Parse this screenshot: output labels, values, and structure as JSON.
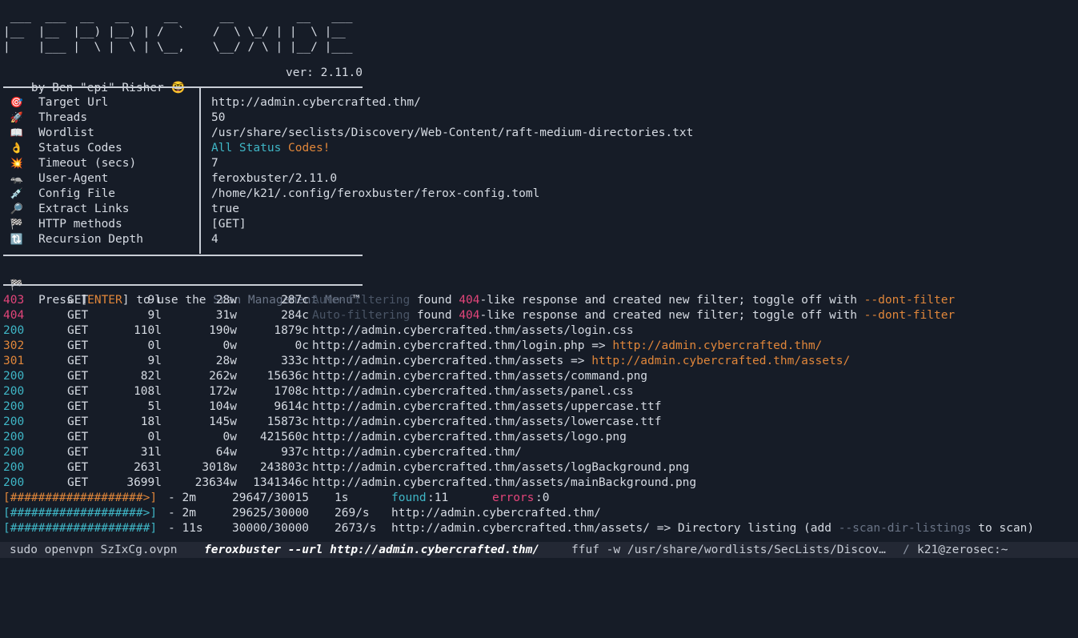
{
  "banner": {
    "ascii_art": " ___  ___  __   __     __      __         __   ___\n|__  |__  |__) |__) | /  `    /  \\ \\_/ | |  \\ |__\n|    |___ |  \\ |  \\ | \\__,    \\__/ / \\ | |__/ |___",
    "byline": "by Ben \"epi\" Risher 🤓",
    "version": "ver: 2.11.0"
  },
  "config": [
    {
      "icon": "🎯",
      "icon_name": "target-icon",
      "key": "Target Url",
      "value": "http://admin.cybercrafted.thm/"
    },
    {
      "icon": "🚀",
      "icon_name": "rocket-icon",
      "key": "Threads",
      "value": "50"
    },
    {
      "icon": "📖",
      "icon_name": "book-icon",
      "key": "Wordlist",
      "value": "/usr/share/seclists/Discovery/Web-Content/raft-medium-directories.txt"
    },
    {
      "icon": "👌",
      "icon_name": "ok-hand-icon",
      "key": "Status Codes",
      "value": ""
    },
    {
      "icon": "💥",
      "icon_name": "explosion-icon",
      "key": "Timeout (secs)",
      "value": "7"
    },
    {
      "icon": "🦡",
      "icon_name": "badger-icon",
      "key": "User-Agent",
      "value": "feroxbuster/2.11.0"
    },
    {
      "icon": "💉",
      "icon_name": "syringe-icon",
      "key": "Config File",
      "value": "/home/k21/.config/feroxbuster/ferox-config.toml"
    },
    {
      "icon": "🔎",
      "icon_name": "magnifier-icon",
      "key": "Extract Links",
      "value": "true"
    },
    {
      "icon": "🏁",
      "icon_name": "checkered-flag-icon",
      "key": "HTTP methods",
      "value": "[GET]"
    },
    {
      "icon": "🔃",
      "icon_name": "recursion-icon",
      "key": "Recursion Depth",
      "value": "4"
    }
  ],
  "status_codes_value": {
    "part1": "All",
    "part2": "Status",
    "part3": "Codes!"
  },
  "press_enter": {
    "icon": "🏁",
    "before": "Press [",
    "key": "ENTER",
    "middle": "] to use the ",
    "menu": "Scan Management Menu",
    "tm": "™"
  },
  "results": [
    {
      "status": "403",
      "method": "GET",
      "lines": "9l",
      "words": "28w",
      "chars": "287c",
      "pre": "Auto-filtering",
      "text": " found ",
      "code": "404",
      "text2": "-like response and created new filter; toggle off with ",
      "flag": "--dont-filter"
    },
    {
      "status": "404",
      "method": "GET",
      "lines": "9l",
      "words": "31w",
      "chars": "284c",
      "pre": "Auto-filtering",
      "text": " found ",
      "code": "404",
      "text2": "-like response and created new filter; toggle off with ",
      "flag": "--dont-filter"
    },
    {
      "status": "200",
      "method": "GET",
      "lines": "110l",
      "words": "190w",
      "chars": "1879c",
      "url": "http://admin.cybercrafted.thm/assets/login.css"
    },
    {
      "status": "302",
      "method": "GET",
      "lines": "0l",
      "words": "0w",
      "chars": "0c",
      "url": "http://admin.cybercrafted.thm/login.php => ",
      "redirect": "http://admin.cybercrafted.thm/"
    },
    {
      "status": "301",
      "method": "GET",
      "lines": "9l",
      "words": "28w",
      "chars": "333c",
      "url": "http://admin.cybercrafted.thm/assets => ",
      "redirect": "http://admin.cybercrafted.thm/assets/"
    },
    {
      "status": "200",
      "method": "GET",
      "lines": "82l",
      "words": "262w",
      "chars": "15636c",
      "url": "http://admin.cybercrafted.thm/assets/command.png"
    },
    {
      "status": "200",
      "method": "GET",
      "lines": "108l",
      "words": "172w",
      "chars": "1708c",
      "url": "http://admin.cybercrafted.thm/assets/panel.css"
    },
    {
      "status": "200",
      "method": "GET",
      "lines": "5l",
      "words": "104w",
      "chars": "9614c",
      "url": "http://admin.cybercrafted.thm/assets/uppercase.ttf"
    },
    {
      "status": "200",
      "method": "GET",
      "lines": "18l",
      "words": "145w",
      "chars": "15873c",
      "url": "http://admin.cybercrafted.thm/assets/lowercase.ttf"
    },
    {
      "status": "200",
      "method": "GET",
      "lines": "0l",
      "words": "0w",
      "chars": "421560c",
      "url": "http://admin.cybercrafted.thm/assets/logo.png"
    },
    {
      "status": "200",
      "method": "GET",
      "lines": "31l",
      "words": "64w",
      "chars": "937c",
      "url": "http://admin.cybercrafted.thm/"
    },
    {
      "status": "200",
      "method": "GET",
      "lines": "263l",
      "words": "3018w",
      "chars": "243803c",
      "url": "http://admin.cybercrafted.thm/assets/logBackground.png"
    },
    {
      "status": "200",
      "method": "GET",
      "lines": "3699l",
      "words": "23634w",
      "chars": "1341346c",
      "url": "http://admin.cybercrafted.thm/assets/mainBackground.png"
    }
  ],
  "progress": [
    {
      "bar": "[###################>]",
      "color": "#e0863a",
      "elapsed": "- 2m",
      "count": "29647/30015",
      "rate": "1s",
      "found_label": "found",
      "found": ":11",
      "errors_label": "errors",
      "errors": ":0"
    },
    {
      "bar": "[###################>]",
      "color": "#3fb6c6",
      "elapsed": "- 2m",
      "count": "29625/30000",
      "rate": "269/s",
      "target": "http://admin.cybercrafted.thm/"
    },
    {
      "bar": "[####################]",
      "color": "#3fb6c6",
      "elapsed": "- 11s",
      "count": "30000/30000",
      "rate": "2673/s",
      "target": "http://admin.cybercrafted.thm/assets/ => Directory listing (add ",
      "flag": "--scan-dir-listings",
      "tail": " to scan)"
    }
  ],
  "statusbar": {
    "tab1": "sudo openvpn SzIxCg.ovpn",
    "tab2": "feroxbuster --url http://admin.cybercrafted.thm/",
    "tab3": "ffuf -w /usr/share/wordlists/SecLists/Discov…",
    "sep": "/",
    "tab4": "k21@zerosec:~"
  },
  "colors": {
    "background": "#161c27",
    "status_200": "#3fb6c6",
    "status_30x": "#e0863a",
    "status_40x": "#e2457a",
    "accent_orange": "#e0863a"
  }
}
